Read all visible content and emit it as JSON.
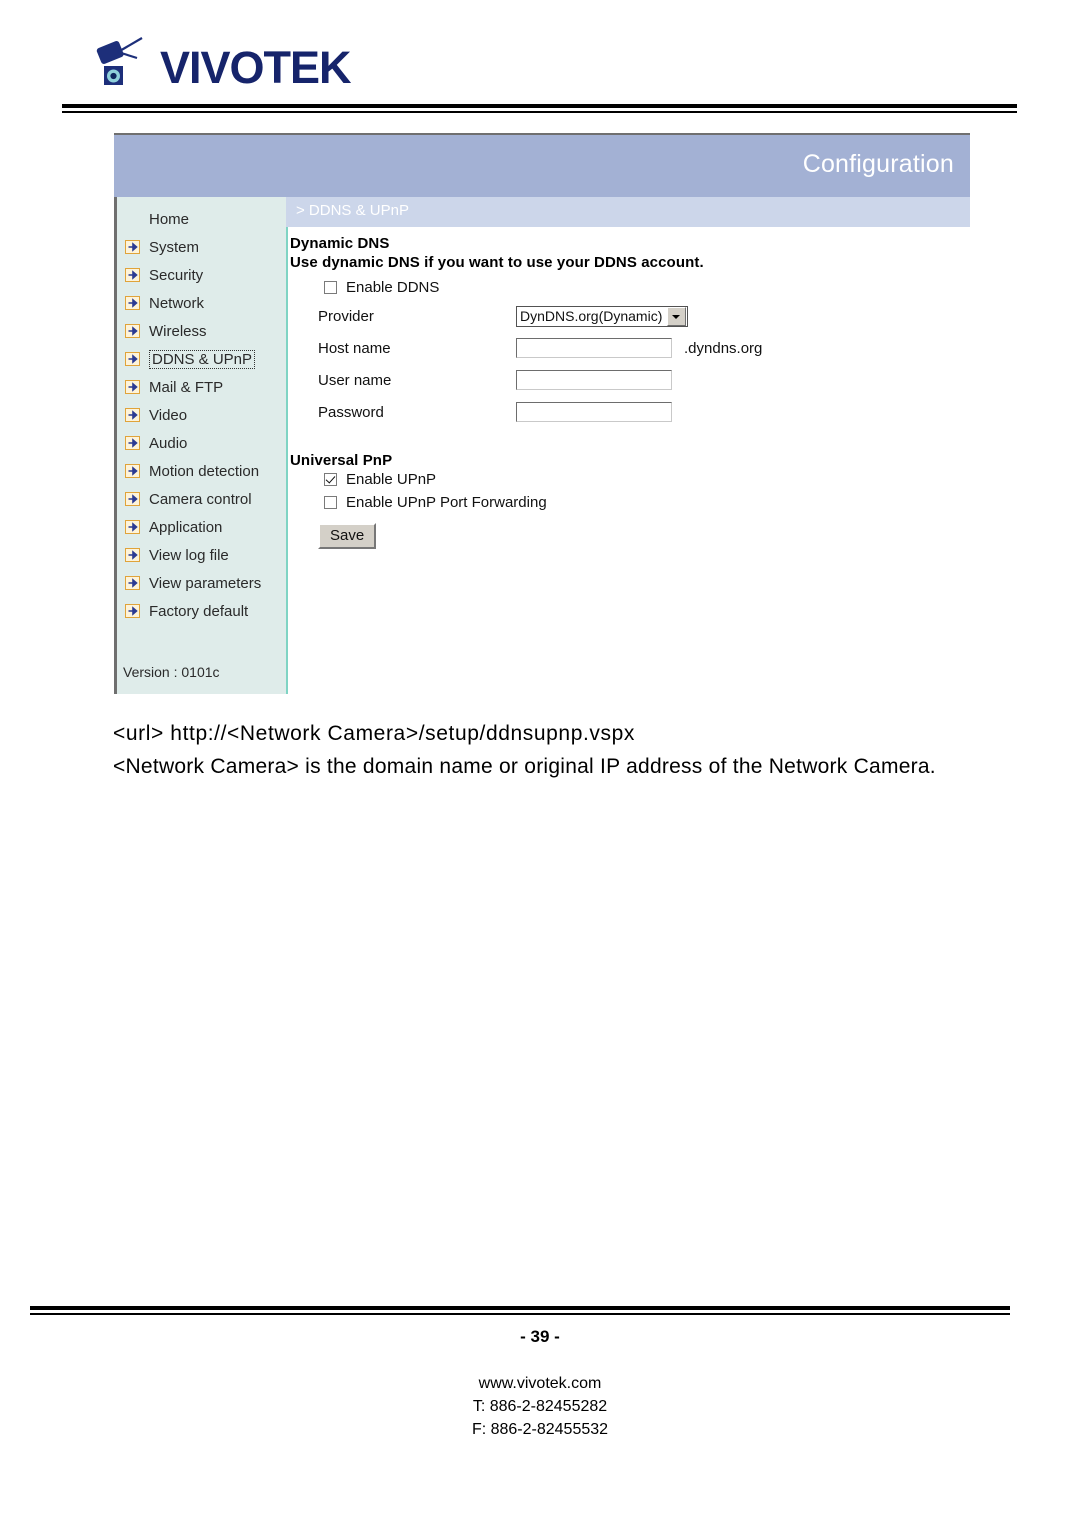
{
  "masthead": {
    "brand": "VIVOTEK",
    "logo_icon": "vivotek-camera-logo"
  },
  "screenshot": {
    "title": "Configuration",
    "breadcrumb": "> DDNS & UPnP",
    "sidebar": {
      "items": [
        {
          "label": "Home",
          "icon": "none",
          "selected": false
        },
        {
          "label": "System",
          "icon": "arrow-right-icon",
          "selected": false
        },
        {
          "label": "Security",
          "icon": "arrow-right-icon",
          "selected": false
        },
        {
          "label": "Network",
          "icon": "arrow-right-icon",
          "selected": false
        },
        {
          "label": "Wireless",
          "icon": "arrow-right-icon",
          "selected": false
        },
        {
          "label": "DDNS & UPnP",
          "icon": "arrow-right-icon",
          "selected": true
        },
        {
          "label": "Mail & FTP",
          "icon": "arrow-right-icon",
          "selected": false
        },
        {
          "label": "Video",
          "icon": "arrow-right-icon",
          "selected": false
        },
        {
          "label": "Audio",
          "icon": "arrow-right-icon",
          "selected": false
        },
        {
          "label": "Motion detection",
          "icon": "arrow-right-icon",
          "selected": false
        },
        {
          "label": "Camera control",
          "icon": "arrow-right-icon",
          "selected": false
        },
        {
          "label": "Application",
          "icon": "arrow-right-icon",
          "selected": false
        },
        {
          "label": "View log file",
          "icon": "arrow-right-icon",
          "selected": false
        },
        {
          "label": "View parameters",
          "icon": "arrow-right-icon",
          "selected": false
        },
        {
          "label": "Factory default",
          "icon": "arrow-right-icon",
          "selected": false
        }
      ],
      "version": "Version : 0101c"
    },
    "dynamic_dns": {
      "heading": "Dynamic DNS",
      "subheading": "Use dynamic DNS if you want to use your DDNS account.",
      "enable_ddns_label": "Enable DDNS",
      "enable_ddns_checked": false,
      "provider_label": "Provider",
      "provider_value": "DynDNS.org(Dynamic)",
      "host_name_label": "Host name",
      "host_name_value": "",
      "host_name_suffix": ".dyndns.org",
      "user_name_label": "User name",
      "user_name_value": "",
      "password_label": "Password",
      "password_value": ""
    },
    "universal_pnp": {
      "heading": "Universal PnP",
      "enable_upnp_label": "Enable UPnP",
      "enable_upnp_checked": true,
      "enable_port_forwarding_label": "Enable UPnP Port Forwarding",
      "enable_port_forwarding_checked": false,
      "save_label": "Save"
    },
    "colors": {
      "header_bar": "#a3b1d4",
      "breadcrumb_bar": "#ccd6ea",
      "sidebar_bg": "#dfecea",
      "separator": "#7fd4c4",
      "logo_blue": "#16246b"
    }
  },
  "caption": {
    "line1": "<url> http://<Network Camera>/setup/ddnsupnp.vspx",
    "line2": "<Network Camera> is the domain name or original IP address of the Network Camera."
  },
  "footer": {
    "page_number": "- 39 -",
    "website": "www.vivotek.com",
    "telephone": "T: 886-2-82455282",
    "fax": "F: 886-2-82455532"
  }
}
